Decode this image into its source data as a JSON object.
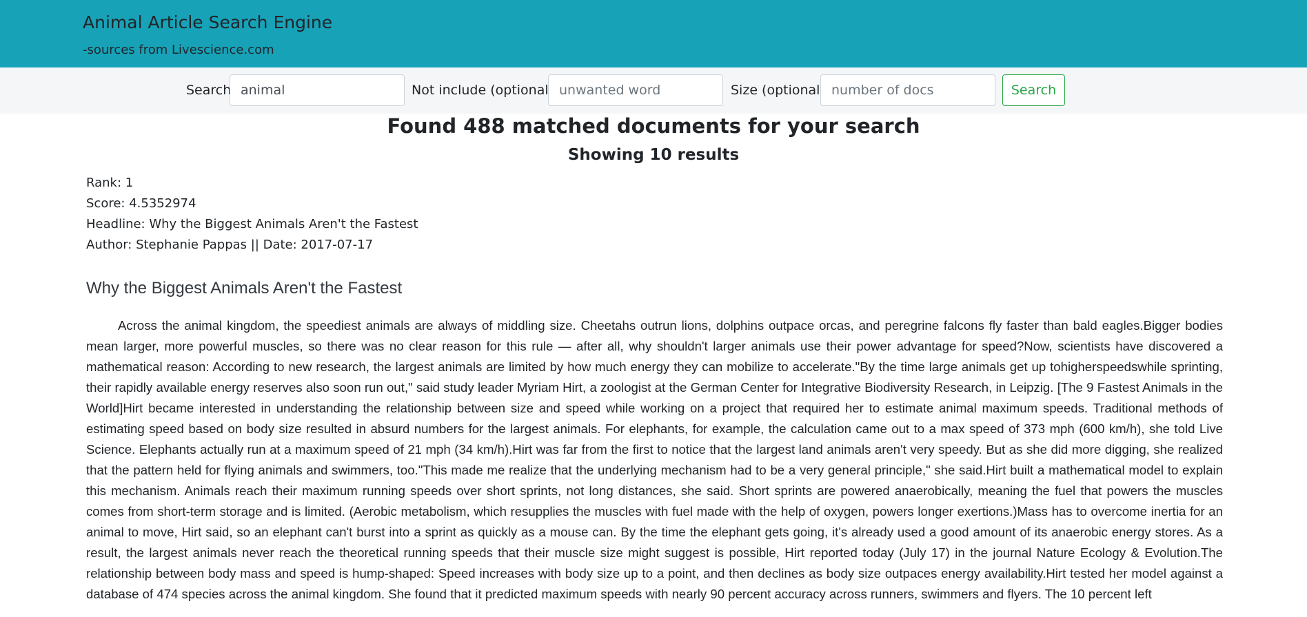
{
  "header": {
    "title": "Animal Article Search Engine",
    "subtitle": "-sources from Livescience.com"
  },
  "search": {
    "search_label": "Search:",
    "search_value": "animal",
    "exclude_label": "Not include (optional):",
    "exclude_placeholder": "unwanted word",
    "size_label": "Size (optional):",
    "size_placeholder": "number of docs",
    "button_label": "Search"
  },
  "results": {
    "found_text": "Found 488 matched documents for your search",
    "showing_text": "Showing 10 results"
  },
  "result": {
    "rank": "Rank: 1",
    "score": "Score: 4.5352974",
    "headline": "Headline: Why the Biggest Animals Aren't the Fastest",
    "author_date": "Author: Stephanie Pappas || Date: 2017-07-17",
    "title": "Why the Biggest Animals Aren't the Fastest",
    "body": "Across the animal kingdom, the speediest animals are always of middling size. Cheetahs outrun lions, dolphins outpace orcas, and peregrine falcons fly faster than bald eagles.Bigger bodies mean larger, more powerful muscles, so there was no clear reason for this rule — after all, why shouldn't larger animals use their power advantage for speed?Now, scientists have discovered a mathematical reason: According to new research, the largest animals are limited by how much energy they can mobilize to accelerate.\"By the time large animals get up tohigherspeedswhile sprinting, their rapidly available energy reserves also soon run out,\" said study leader Myriam Hirt, a zoologist at the German Center for Integrative Biodiversity Research, in Leipzig. [The 9 Fastest Animals in the World]Hirt became interested in understanding the relationship between size and speed while working on a project that required her to estimate animal maximum speeds. Traditional methods of estimating speed based on body size resulted in absurd numbers for the largest animals. For elephants, for example, the calculation came out to a max speed of 373 mph (600 km/h), she told Live Science. Elephants actually run at a maximum speed of 21 mph (34 km/h).Hirt was far from the first to notice that the largest land animals aren't very speedy. But as she did more digging, she realized that the pattern held for flying animals and swimmers, too.\"This made me realize that the underlying mechanism had to be a very general principle,\" she said.Hirt built a mathematical model to explain this mechanism. Animals reach their maximum running speeds over short sprints, not long distances, she said. Short sprints are powered anaerobically, meaning the fuel that powers the muscles comes from short-term storage and is limited. (Aerobic metabolism, which resupplies the muscles with fuel made with the help of oxygen, powers longer exertions.)Mass has to overcome inertia for an animal to move, Hirt said, so an elephant can't burst into a sprint as quickly as a mouse can. By the time the elephant gets going, it's already used a good amount of its anaerobic energy stores. As a result, the largest animals never reach the theoretical running speeds that their muscle size might suggest is possible, Hirt reported today (July 17) in the journal Nature Ecology & Evolution.The relationship between body mass and speed is hump-shaped: Speed increases with body size up to a point, and then declines as body size outpaces energy availability.Hirt tested her model against a database of 474 species across the animal kingdom. She found that it predicted maximum speeds with nearly 90 percent accuracy across runners, swimmers and flyers. The 10 percent left"
  },
  "colors": {
    "header_bg": "#17a2b8",
    "search_bar_bg": "#f5f6f7",
    "button_accent": "#28a745"
  }
}
